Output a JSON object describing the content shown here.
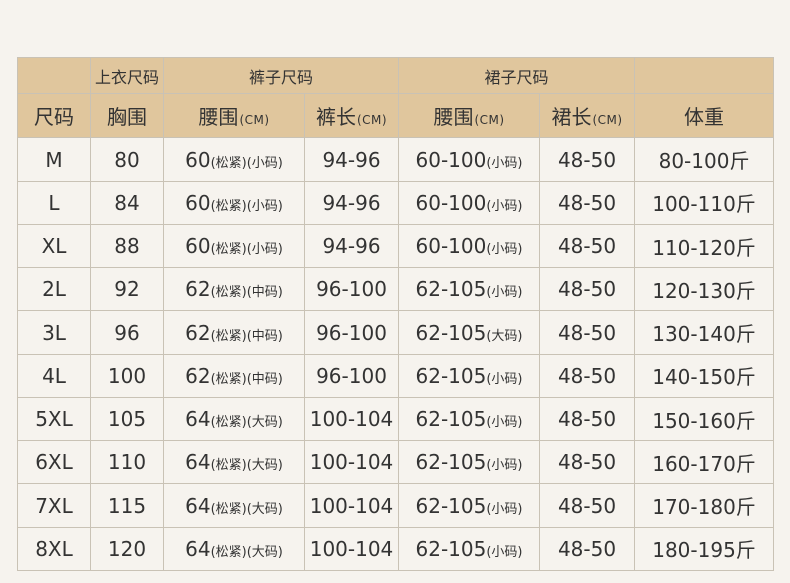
{
  "header": {
    "group_top": "上衣尺码",
    "group_pants": "裤子尺码",
    "group_skirt": "裙子尺码",
    "col_size": "尺码",
    "col_chest": "胸围",
    "col_pants_waist": "腰围",
    "col_pants_length": "裤长",
    "col_skirt_waist": "腰围",
    "col_skirt_length": "裙长",
    "col_weight": "体重",
    "unit": "(CM)"
  },
  "rows": [
    {
      "size": "M",
      "chest": "80",
      "pants_waist": "60",
      "pants_waist_note": "(松紧)(小码)",
      "pants_length": "94-96",
      "skirt_waist": "60-100",
      "skirt_waist_note": "(小码)",
      "skirt_length": "48-50",
      "weight": "80-100斤"
    },
    {
      "size": "L",
      "chest": "84",
      "pants_waist": "60",
      "pants_waist_note": "(松紧)(小码)",
      "pants_length": "94-96",
      "skirt_waist": "60-100",
      "skirt_waist_note": "(小码)",
      "skirt_length": "48-50",
      "weight": "100-110斤"
    },
    {
      "size": "XL",
      "chest": "88",
      "pants_waist": "60",
      "pants_waist_note": "(松紧)(小码)",
      "pants_length": "94-96",
      "skirt_waist": "60-100",
      "skirt_waist_note": "(小码)",
      "skirt_length": "48-50",
      "weight": "110-120斤"
    },
    {
      "size": "2L",
      "chest": "92",
      "pants_waist": "62",
      "pants_waist_note": "(松紧)(中码)",
      "pants_length": "96-100",
      "skirt_waist": "62-105",
      "skirt_waist_note": "(小码)",
      "skirt_length": "48-50",
      "weight": "120-130斤"
    },
    {
      "size": "3L",
      "chest": "96",
      "pants_waist": "62",
      "pants_waist_note": "(松紧)(中码)",
      "pants_length": "96-100",
      "skirt_waist": "62-105",
      "skirt_waist_note": "(大码)",
      "skirt_length": "48-50",
      "weight": "130-140斤"
    },
    {
      "size": "4L",
      "chest": "100",
      "pants_waist": "62",
      "pants_waist_note": "(松紧)(中码)",
      "pants_length": "96-100",
      "skirt_waist": "62-105",
      "skirt_waist_note": "(小码)",
      "skirt_length": "48-50",
      "weight": "140-150斤"
    },
    {
      "size": "5XL",
      "chest": "105",
      "pants_waist": "64",
      "pants_waist_note": "(松紧)(大码)",
      "pants_length": "100-104",
      "skirt_waist": "62-105",
      "skirt_waist_note": "(小码)",
      "skirt_length": "48-50",
      "weight": "150-160斤"
    },
    {
      "size": "6XL",
      "chest": "110",
      "pants_waist": "64",
      "pants_waist_note": "(松紧)(大码)",
      "pants_length": "100-104",
      "skirt_waist": "62-105",
      "skirt_waist_note": "(小码)",
      "skirt_length": "48-50",
      "weight": "160-170斤"
    },
    {
      "size": "7XL",
      "chest": "115",
      "pants_waist": "64",
      "pants_waist_note": "(松紧)(大码)",
      "pants_length": "100-104",
      "skirt_waist": "62-105",
      "skirt_waist_note": "(小码)",
      "skirt_length": "48-50",
      "weight": "170-180斤"
    },
    {
      "size": "8XL",
      "chest": "120",
      "pants_waist": "64",
      "pants_waist_note": "(松紧)(大码)",
      "pants_length": "100-104",
      "skirt_waist": "62-105",
      "skirt_waist_note": "(小码)",
      "skirt_length": "48-50",
      "weight": "180-195斤"
    }
  ],
  "colors": {
    "header_bg": "#e0c69d",
    "page_bg": "#f6f3ee",
    "border": "#c9c2b5",
    "text": "#333333"
  }
}
